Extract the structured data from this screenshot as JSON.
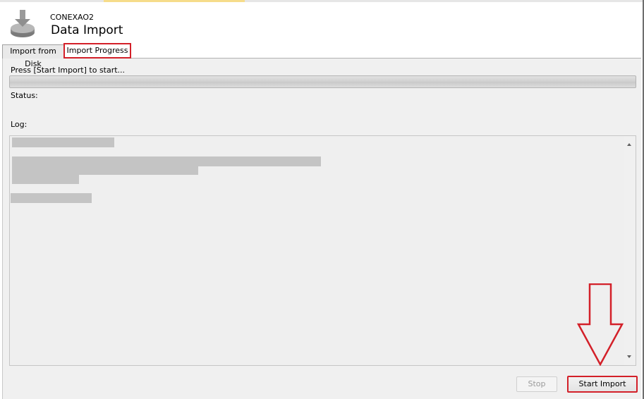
{
  "header": {
    "connection_name": "CONEXAO2",
    "title": "Data Import"
  },
  "tabs": [
    {
      "label": "Import from Disk",
      "selected": false
    },
    {
      "label": "Import Progress",
      "selected": true
    }
  ],
  "progress": {
    "hint": "Press [Start Import] to start...",
    "status_label": "Status:",
    "log_label": "Log:",
    "value": 0
  },
  "buttons": {
    "stop": "Stop",
    "start_import": "Start Import"
  },
  "colors": {
    "annotation": "#d32029",
    "progress_fill": "#06b025"
  }
}
